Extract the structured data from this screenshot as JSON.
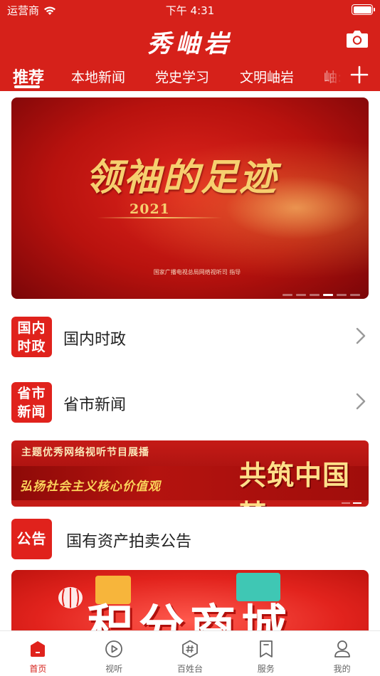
{
  "status_bar": {
    "carrier": "运营商",
    "time": "下午 4:31"
  },
  "header": {
    "title": "秀岫岩",
    "camera_icon": "camera-icon",
    "add_icon": "plus-icon"
  },
  "tabs": [
    {
      "label": "推荐",
      "active": true
    },
    {
      "label": "本地新闻",
      "active": false
    },
    {
      "label": "党史学习",
      "active": false
    },
    {
      "label": "文明岫岩",
      "active": false
    },
    {
      "label": "岫:",
      "active": false
    }
  ],
  "banner": {
    "title": "领袖的足迹",
    "year": "2021",
    "credit": "国家广播电视总局网络视听司  指导",
    "slide_count": 6,
    "active_slide": 4
  },
  "rows": [
    {
      "badge_line1": "国内",
      "badge_line2": "时政",
      "label": "国内时政"
    },
    {
      "badge_line1": "省市",
      "badge_line2": "新闻",
      "label": "省市新闻"
    }
  ],
  "promo": {
    "top": "主题优秀网络视听节目展播",
    "left": "弘扬社会主义核心价值观",
    "big": "共筑中国梦"
  },
  "notice": {
    "badge": "公告",
    "label": "国有资产拍卖公告"
  },
  "mall": {
    "text": "积分商城"
  },
  "tabbar": [
    {
      "label": "首页",
      "icon": "home-icon",
      "active": true
    },
    {
      "label": "视听",
      "icon": "play-icon",
      "active": false
    },
    {
      "label": "百姓台",
      "icon": "hashtag-icon",
      "active": false
    },
    {
      "label": "服务",
      "icon": "bookmark-icon",
      "active": false
    },
    {
      "label": "我的",
      "icon": "user-icon",
      "active": false
    }
  ],
  "colors": {
    "brand_red": "#d6211a",
    "badge_red": "#e0221c",
    "gold": "#f6cf6f"
  }
}
